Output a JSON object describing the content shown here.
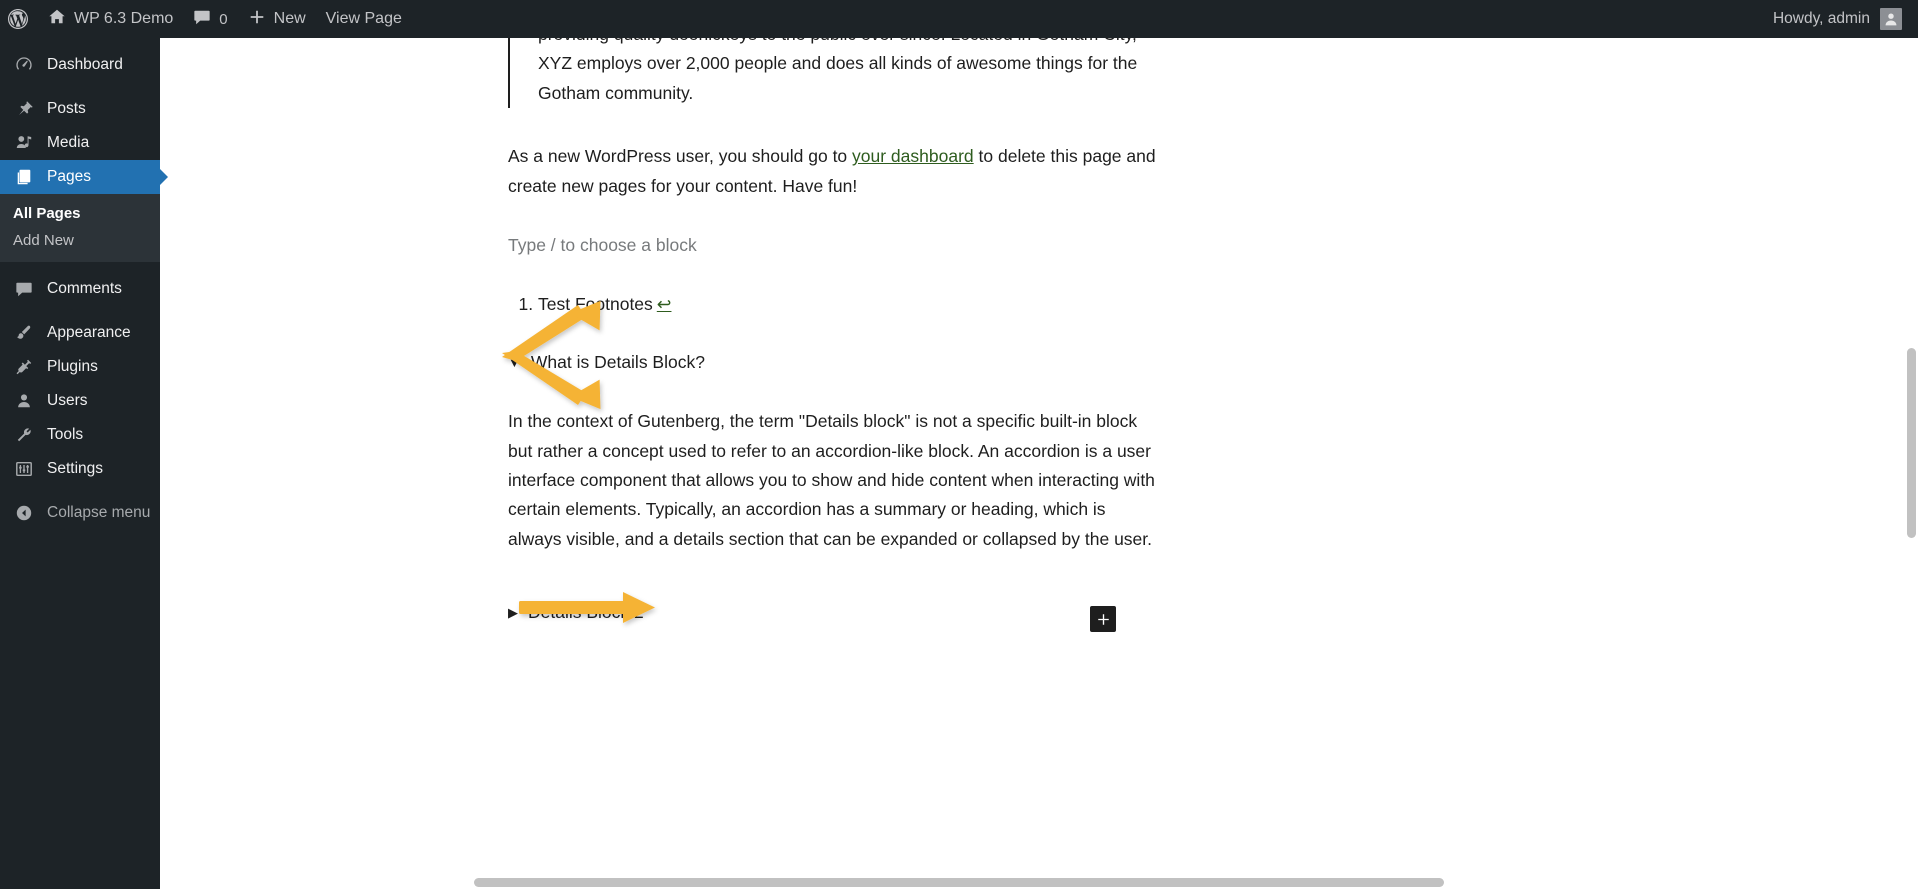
{
  "adminbar": {
    "logo_icon": "wordpress-logo-icon",
    "site_icon": "home-icon",
    "site_name": "WP 6.3 Demo",
    "comments_icon": "comment-bubble-icon",
    "comments_count": "0",
    "new_icon": "plus-icon",
    "new_label": "New",
    "view_page_label": "View Page",
    "howdy_label": "Howdy, admin",
    "avatar_icon": "user-avatar-icon"
  },
  "sidebar": {
    "items": [
      {
        "label": "Dashboard",
        "icon": "dashboard-icon",
        "current": false
      },
      {
        "label": "Posts",
        "icon": "pin-icon",
        "current": false
      },
      {
        "label": "Media",
        "icon": "media-icon",
        "current": false
      },
      {
        "label": "Pages",
        "icon": "pages-icon",
        "current": true
      },
      {
        "label": "Comments",
        "icon": "comment-bubble-icon",
        "current": false
      },
      {
        "label": "Appearance",
        "icon": "paintbrush-icon",
        "current": false
      },
      {
        "label": "Plugins",
        "icon": "plug-icon",
        "current": false
      },
      {
        "label": "Users",
        "icon": "user-icon",
        "current": false
      },
      {
        "label": "Tools",
        "icon": "wrench-icon",
        "current": false
      },
      {
        "label": "Settings",
        "icon": "sliders-icon",
        "current": false
      }
    ],
    "submenu": [
      {
        "label": "All Pages",
        "current": true
      },
      {
        "label": "Add New",
        "current": false
      }
    ],
    "collapse": {
      "label": "Collapse menu",
      "icon": "chevron-left-circle-icon"
    }
  },
  "editor": {
    "blockquote": "providing quality doohickeys to the public ever since. Located in Gotham City, XYZ employs over 2,000 people and does all kinds of awesome things for the Gotham community.",
    "paragraph_before_link": "As a new WordPress user, you should go to ",
    "paragraph_link": "your dashboard",
    "paragraph_after_link": " to delete this page and create new pages for your content. Have fun!",
    "block_placeholder": "Type / to choose a block",
    "footnotes": [
      {
        "text": "Test Footnotes",
        "backref_icon": "return-arrow-icon",
        "backref_glyph": "↩"
      }
    ],
    "details_blocks": [
      {
        "marker_icon": "triangle-down-icon",
        "marker_glyph": "▼",
        "open": true,
        "summary": "What is Details Block?",
        "body": "In the context of Gutenberg, the term \"Details block\" is not a specific built-in block but rather a concept used to refer to an accordion-like block. An accordion is a user interface component that allows you to show and hide content when interacting with certain elements. Typically, an accordion has a summary or heading, which is always visible, and a details section that can be expanded or collapsed by the user."
      },
      {
        "marker_icon": "triangle-right-icon",
        "marker_glyph": "▶",
        "open": false,
        "summary": "Details Block 2",
        "body": ""
      }
    ],
    "add_block_button": {
      "icon": "plus-icon",
      "glyph": "+"
    }
  },
  "annotations": [
    {
      "name": "chevron-annotation",
      "shape": "double-headed-chevron",
      "color": "#F5B335",
      "points_to": "What is Details Block?"
    },
    {
      "name": "arrow-annotation",
      "shape": "right-arrow",
      "color": "#F5B335",
      "points_to": "Details Block 2"
    }
  ],
  "colors": {
    "admin_dark": "#1d2327",
    "admin_submenu": "#2c3338",
    "admin_accent_blue": "#2271b1",
    "annotation_yellow": "#F5B335",
    "link_green": "#2e5c1e",
    "text_dark": "#1e1e1e",
    "placeholder_gray": "#777a7c"
  },
  "scrollbars": {
    "vertical_thumb": "vertical-scrollbar-thumb",
    "horizontal_thumb": "horizontal-scrollbar-thumb"
  }
}
